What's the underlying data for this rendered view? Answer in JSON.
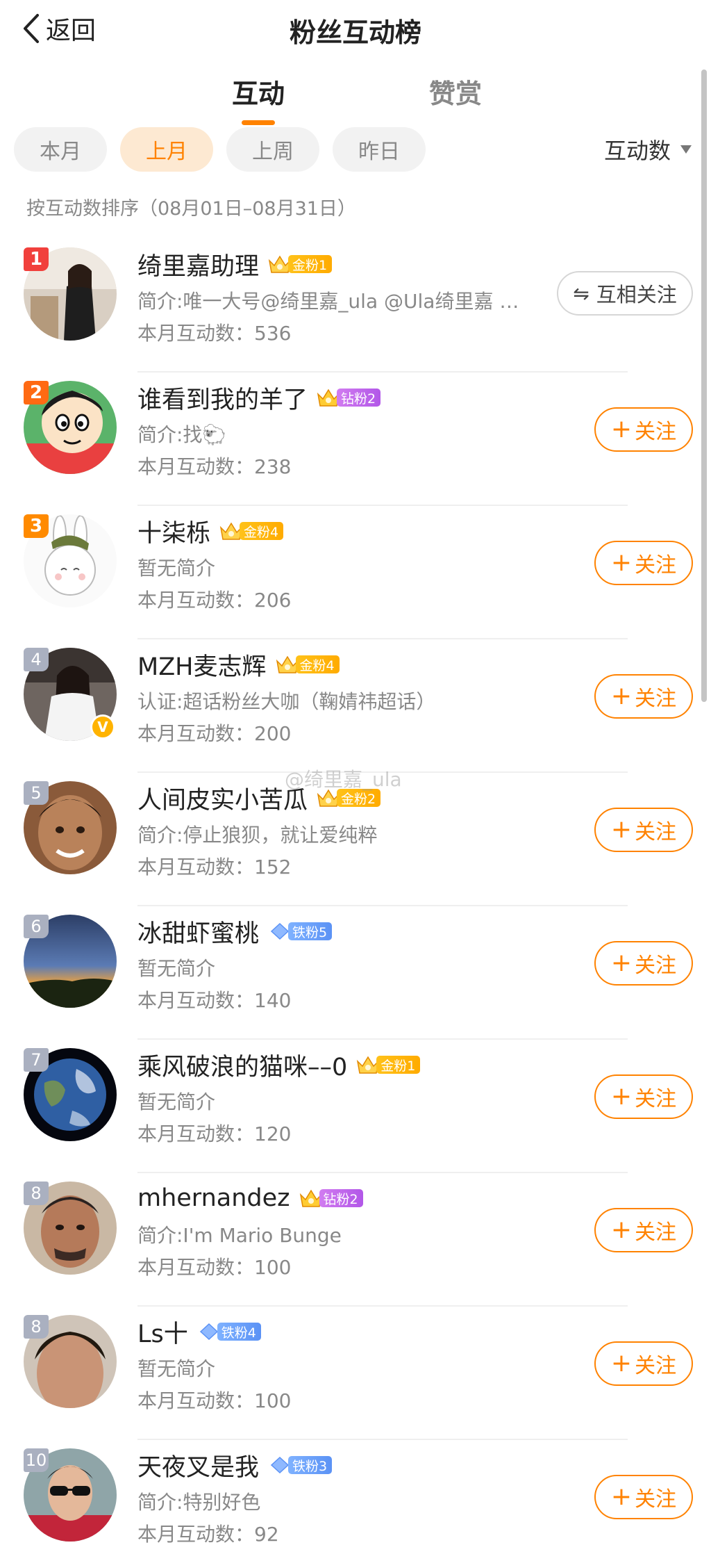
{
  "header": {
    "back_label": "返回",
    "title": "粉丝互动榜"
  },
  "tabs": [
    {
      "label": "互动",
      "active": true
    },
    {
      "label": "赞赏",
      "active": false
    }
  ],
  "periods": [
    {
      "label": "本月",
      "active": false
    },
    {
      "label": "上月",
      "active": true
    },
    {
      "label": "上周",
      "active": false
    },
    {
      "label": "昨日",
      "active": false
    }
  ],
  "sort": {
    "label": "互动数"
  },
  "sort_note": "按互动数排序（08月01日–08月31日）",
  "count_label": "本月互动数：",
  "follow_label": "关注",
  "mutual_label": "互相关注",
  "watermark": "@绮里嘉_ula",
  "colors": {
    "accent": "#ff8200",
    "rank1": "#f1403c",
    "rank2": "#ff6a13",
    "rank3": "#ff8a00"
  },
  "fans": [
    {
      "rank": "1",
      "name": "绮里嘉助理",
      "badge_type": "gold",
      "badge_text": "金粉1",
      "bio": "简介:唯一大号@绮里嘉_ula @Ula绮里嘉 @...",
      "count": "536",
      "button": "mutual"
    },
    {
      "rank": "2",
      "name": "谁看到我的羊了",
      "badge_type": "diamond",
      "badge_text": "钻粉2",
      "bio": "简介:找🐑",
      "count": "238",
      "button": "follow"
    },
    {
      "rank": "3",
      "name": "十柒栎",
      "badge_type": "gold",
      "badge_text": "金粉4",
      "bio": "暂无简介",
      "count": "206",
      "button": "follow"
    },
    {
      "rank": "4",
      "name": "MZH麦志辉",
      "badge_type": "gold",
      "badge_text": "金粉4",
      "bio": "认证:超话粉丝大咖（鞠婧祎超话）",
      "count": "200",
      "button": "follow",
      "verified": true
    },
    {
      "rank": "5",
      "name": "人间皮实小苦瓜",
      "badge_type": "gold",
      "badge_text": "金粉2",
      "bio": "简介:停止狼狈，就让爱纯粹",
      "count": "152",
      "button": "follow"
    },
    {
      "rank": "6",
      "name": "冰甜虾蜜桃",
      "badge_type": "iron",
      "badge_text": "铁粉5",
      "bio": "暂无简介",
      "count": "140",
      "button": "follow"
    },
    {
      "rank": "7",
      "name": "乘风破浪的猫咪––0",
      "badge_type": "gold",
      "badge_text": "金粉1",
      "bio": "暂无简介",
      "count": "120",
      "button": "follow"
    },
    {
      "rank": "8",
      "name": "mhernandez",
      "badge_type": "diamond",
      "badge_text": "钻粉2",
      "bio": "简介:I'm Mario Bunge",
      "count": "100",
      "button": "follow"
    },
    {
      "rank": "8",
      "name": "Ls十",
      "badge_type": "iron",
      "badge_text": "铁粉4",
      "bio": "暂无简介",
      "count": "100",
      "button": "follow"
    },
    {
      "rank": "10",
      "name": "天夜叉是我",
      "badge_type": "iron",
      "badge_text": "铁粉3",
      "bio": "简介:特别好色",
      "count": "92",
      "button": "follow"
    }
  ]
}
